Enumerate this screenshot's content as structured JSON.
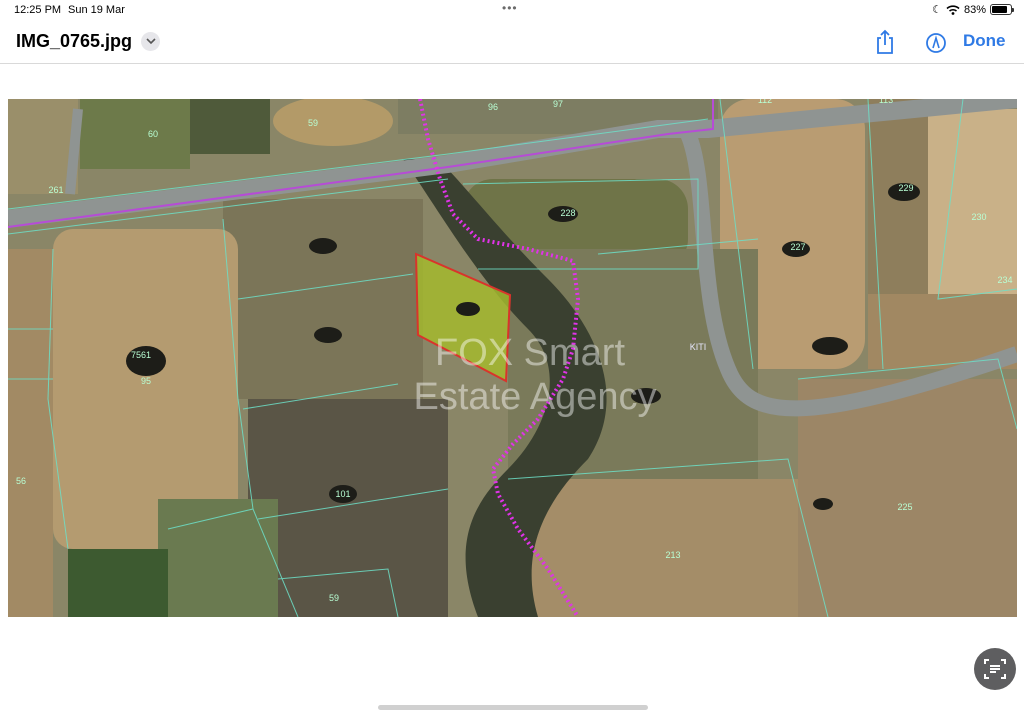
{
  "status_bar": {
    "time": "12:25 PM",
    "date": "Sun 19 Mar",
    "battery_percent": "83%",
    "battery_level": 0.83,
    "icons": [
      "moon-icon",
      "wifi-icon",
      "battery-icon"
    ]
  },
  "nav": {
    "title": "IMG_0765.jpg",
    "title_icon": "chevron-down-icon",
    "share_icon": "share-icon",
    "markup_icon": "markup-icon",
    "done_label": "Done",
    "accent_color": "#2f7ae5"
  },
  "map": {
    "watermark_line1": "FOX Smart",
    "watermark_line2": "Estate Agency",
    "highlight_color": "#a3b82e",
    "boundary_color": "#d61ae0",
    "parcel_labels": [
      "60",
      "59",
      "96",
      "97",
      "112",
      "113",
      "261",
      "229",
      "230",
      "234",
      "228",
      "227",
      "7561",
      "95",
      "56",
      "101",
      "213",
      "225",
      "59",
      "KITI"
    ]
  },
  "scan_icon": "live-text-icon"
}
